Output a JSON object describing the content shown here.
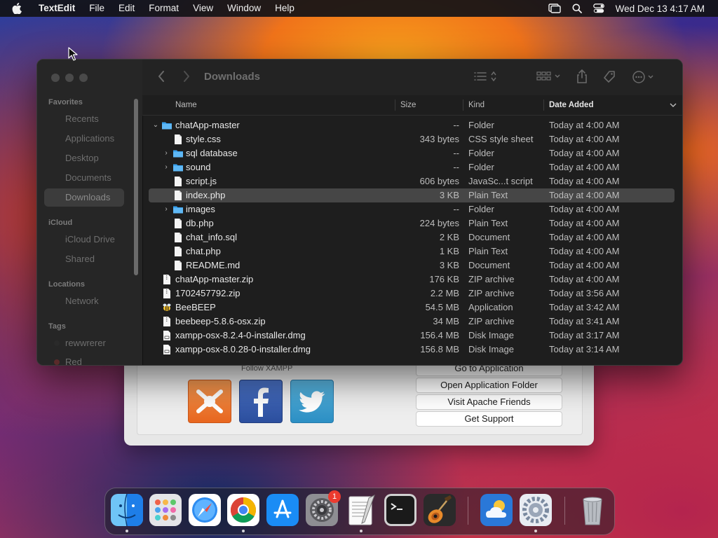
{
  "menubar": {
    "app_name": "TextEdit",
    "items": [
      "File",
      "Edit",
      "Format",
      "View",
      "Window",
      "Help"
    ],
    "clock": "Wed Dec 13  4:17 AM"
  },
  "finder": {
    "title": "Downloads",
    "sidebar": {
      "favorites_label": "Favorites",
      "favorites": [
        "Recents",
        "Applications",
        "Desktop",
        "Documents",
        "Downloads"
      ],
      "icloud_label": "iCloud",
      "icloud": [
        "iCloud Drive",
        "Shared"
      ],
      "locations_label": "Locations",
      "locations": [
        "Network"
      ],
      "tags_label": "Tags",
      "tags": [
        "rewwrerer",
        "Red"
      ]
    },
    "columns": {
      "name": "Name",
      "size": "Size",
      "kind": "Kind",
      "date": "Date Added"
    },
    "rows": [
      {
        "name": "chatApp-master",
        "size": "--",
        "kind": "Folder",
        "date": "Today at 4:00 AM"
      },
      {
        "name": "style.css",
        "size": "343 bytes",
        "kind": "CSS style sheet",
        "date": "Today at 4:00 AM"
      },
      {
        "name": "sql database",
        "size": "--",
        "kind": "Folder",
        "date": "Today at 4:00 AM"
      },
      {
        "name": "sound",
        "size": "--",
        "kind": "Folder",
        "date": "Today at 4:00 AM"
      },
      {
        "name": "script.js",
        "size": "606 bytes",
        "kind": "JavaSc...t script",
        "date": "Today at 4:00 AM"
      },
      {
        "name": "index.php",
        "size": "3 KB",
        "kind": "Plain Text",
        "date": "Today at 4:00 AM"
      },
      {
        "name": "images",
        "size": "--",
        "kind": "Folder",
        "date": "Today at 4:00 AM"
      },
      {
        "name": "db.php",
        "size": "224 bytes",
        "kind": "Plain Text",
        "date": "Today at 4:00 AM"
      },
      {
        "name": "chat_info.sql",
        "size": "2 KB",
        "kind": "Document",
        "date": "Today at 4:00 AM"
      },
      {
        "name": "chat.php",
        "size": "1 KB",
        "kind": "Plain Text",
        "date": "Today at 4:00 AM"
      },
      {
        "name": "README.md",
        "size": "3 KB",
        "kind": "Document",
        "date": "Today at 4:00 AM"
      },
      {
        "name": "chatApp-master.zip",
        "size": "176 KB",
        "kind": "ZIP archive",
        "date": "Today at 4:00 AM"
      },
      {
        "name": "1702457792.zip",
        "size": "2.2 MB",
        "kind": "ZIP archive",
        "date": "Today at 3:56 AM"
      },
      {
        "name": "BeeBEEP",
        "size": "54.5 MB",
        "kind": "Application",
        "date": "Today at 3:42 AM"
      },
      {
        "name": "beebeep-5.8.6-osx.zip",
        "size": "34 MB",
        "kind": "ZIP archive",
        "date": "Today at 3:41 AM"
      },
      {
        "name": "xampp-osx-8.2.4-0-installer.dmg",
        "size": "156.4 MB",
        "kind": "Disk Image",
        "date": "Today at 3:17 AM"
      },
      {
        "name": "xampp-osx-8.0.28-0-installer.dmg",
        "size": "156.8 MB",
        "kind": "Disk Image",
        "date": "Today at 3:14 AM"
      }
    ]
  },
  "xampp": {
    "follow_label": "Follow  XAMPP",
    "buttons": [
      "Go to Application",
      "Open Application Folder",
      "Visit Apache Friends",
      "Get Support"
    ]
  },
  "dock": {
    "settings_badge": "1"
  }
}
